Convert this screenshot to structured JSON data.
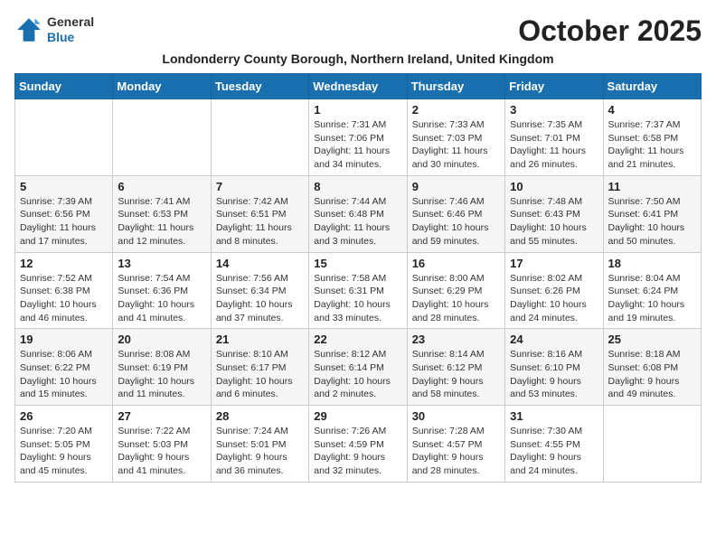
{
  "header": {
    "logo_general": "General",
    "logo_blue": "Blue",
    "title": "October 2025",
    "subtitle": "Londonderry County Borough, Northern Ireland, United Kingdom"
  },
  "weekdays": [
    "Sunday",
    "Monday",
    "Tuesday",
    "Wednesday",
    "Thursday",
    "Friday",
    "Saturday"
  ],
  "weeks": [
    [
      {
        "day": "",
        "info": ""
      },
      {
        "day": "",
        "info": ""
      },
      {
        "day": "",
        "info": ""
      },
      {
        "day": "1",
        "info": "Sunrise: 7:31 AM\nSunset: 7:06 PM\nDaylight: 11 hours and 34 minutes."
      },
      {
        "day": "2",
        "info": "Sunrise: 7:33 AM\nSunset: 7:03 PM\nDaylight: 11 hours and 30 minutes."
      },
      {
        "day": "3",
        "info": "Sunrise: 7:35 AM\nSunset: 7:01 PM\nDaylight: 11 hours and 26 minutes."
      },
      {
        "day": "4",
        "info": "Sunrise: 7:37 AM\nSunset: 6:58 PM\nDaylight: 11 hours and 21 minutes."
      }
    ],
    [
      {
        "day": "5",
        "info": "Sunrise: 7:39 AM\nSunset: 6:56 PM\nDaylight: 11 hours and 17 minutes."
      },
      {
        "day": "6",
        "info": "Sunrise: 7:41 AM\nSunset: 6:53 PM\nDaylight: 11 hours and 12 minutes."
      },
      {
        "day": "7",
        "info": "Sunrise: 7:42 AM\nSunset: 6:51 PM\nDaylight: 11 hours and 8 minutes."
      },
      {
        "day": "8",
        "info": "Sunrise: 7:44 AM\nSunset: 6:48 PM\nDaylight: 11 hours and 3 minutes."
      },
      {
        "day": "9",
        "info": "Sunrise: 7:46 AM\nSunset: 6:46 PM\nDaylight: 10 hours and 59 minutes."
      },
      {
        "day": "10",
        "info": "Sunrise: 7:48 AM\nSunset: 6:43 PM\nDaylight: 10 hours and 55 minutes."
      },
      {
        "day": "11",
        "info": "Sunrise: 7:50 AM\nSunset: 6:41 PM\nDaylight: 10 hours and 50 minutes."
      }
    ],
    [
      {
        "day": "12",
        "info": "Sunrise: 7:52 AM\nSunset: 6:38 PM\nDaylight: 10 hours and 46 minutes."
      },
      {
        "day": "13",
        "info": "Sunrise: 7:54 AM\nSunset: 6:36 PM\nDaylight: 10 hours and 41 minutes."
      },
      {
        "day": "14",
        "info": "Sunrise: 7:56 AM\nSunset: 6:34 PM\nDaylight: 10 hours and 37 minutes."
      },
      {
        "day": "15",
        "info": "Sunrise: 7:58 AM\nSunset: 6:31 PM\nDaylight: 10 hours and 33 minutes."
      },
      {
        "day": "16",
        "info": "Sunrise: 8:00 AM\nSunset: 6:29 PM\nDaylight: 10 hours and 28 minutes."
      },
      {
        "day": "17",
        "info": "Sunrise: 8:02 AM\nSunset: 6:26 PM\nDaylight: 10 hours and 24 minutes."
      },
      {
        "day": "18",
        "info": "Sunrise: 8:04 AM\nSunset: 6:24 PM\nDaylight: 10 hours and 19 minutes."
      }
    ],
    [
      {
        "day": "19",
        "info": "Sunrise: 8:06 AM\nSunset: 6:22 PM\nDaylight: 10 hours and 15 minutes."
      },
      {
        "day": "20",
        "info": "Sunrise: 8:08 AM\nSunset: 6:19 PM\nDaylight: 10 hours and 11 minutes."
      },
      {
        "day": "21",
        "info": "Sunrise: 8:10 AM\nSunset: 6:17 PM\nDaylight: 10 hours and 6 minutes."
      },
      {
        "day": "22",
        "info": "Sunrise: 8:12 AM\nSunset: 6:14 PM\nDaylight: 10 hours and 2 minutes."
      },
      {
        "day": "23",
        "info": "Sunrise: 8:14 AM\nSunset: 6:12 PM\nDaylight: 9 hours and 58 minutes."
      },
      {
        "day": "24",
        "info": "Sunrise: 8:16 AM\nSunset: 6:10 PM\nDaylight: 9 hours and 53 minutes."
      },
      {
        "day": "25",
        "info": "Sunrise: 8:18 AM\nSunset: 6:08 PM\nDaylight: 9 hours and 49 minutes."
      }
    ],
    [
      {
        "day": "26",
        "info": "Sunrise: 7:20 AM\nSunset: 5:05 PM\nDaylight: 9 hours and 45 minutes."
      },
      {
        "day": "27",
        "info": "Sunrise: 7:22 AM\nSunset: 5:03 PM\nDaylight: 9 hours and 41 minutes."
      },
      {
        "day": "28",
        "info": "Sunrise: 7:24 AM\nSunset: 5:01 PM\nDaylight: 9 hours and 36 minutes."
      },
      {
        "day": "29",
        "info": "Sunrise: 7:26 AM\nSunset: 4:59 PM\nDaylight: 9 hours and 32 minutes."
      },
      {
        "day": "30",
        "info": "Sunrise: 7:28 AM\nSunset: 4:57 PM\nDaylight: 9 hours and 28 minutes."
      },
      {
        "day": "31",
        "info": "Sunrise: 7:30 AM\nSunset: 4:55 PM\nDaylight: 9 hours and 24 minutes."
      },
      {
        "day": "",
        "info": ""
      }
    ]
  ]
}
